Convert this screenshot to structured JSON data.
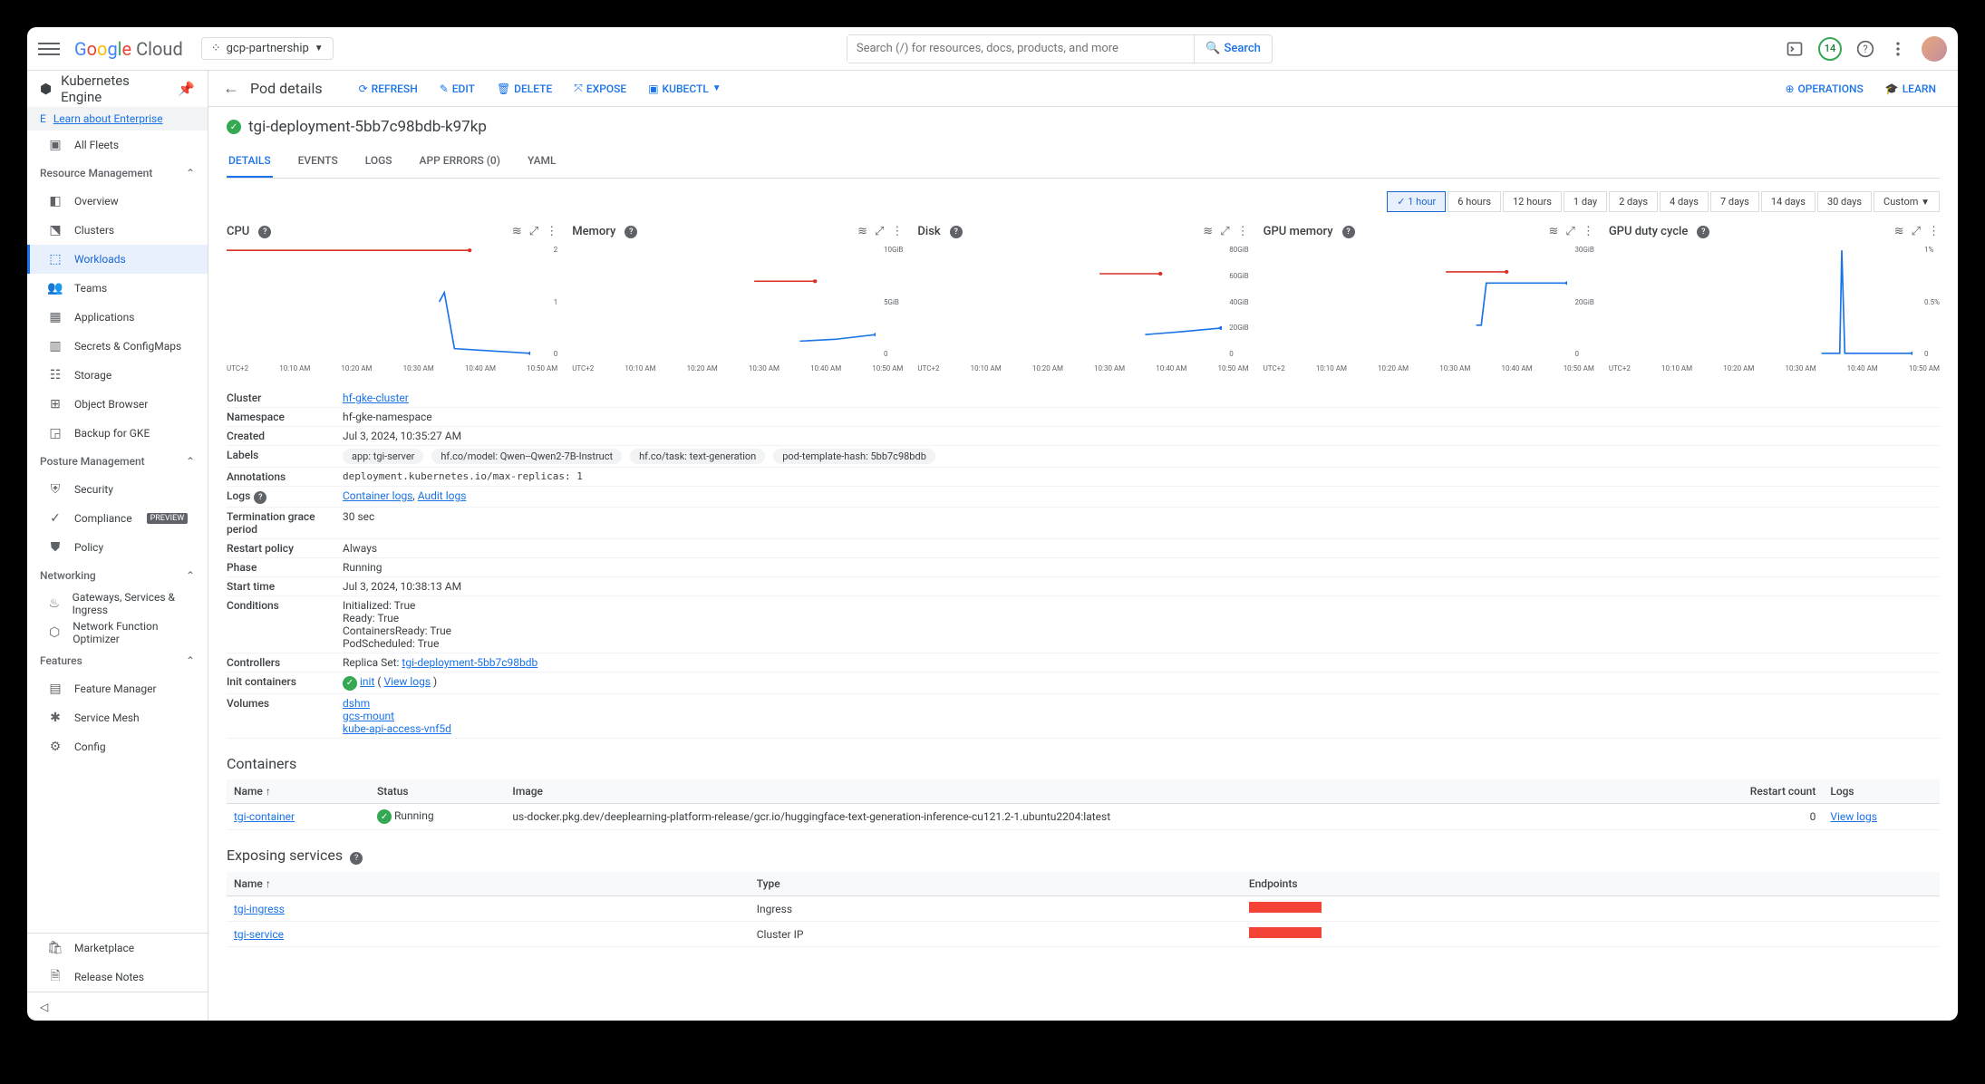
{
  "header": {
    "logo_text": "Google Cloud",
    "project": "gcp-partnership",
    "search_placeholder": "Search (/) for resources, docs, products, and more",
    "search_btn": "Search",
    "trial_badge": "14"
  },
  "sidebar": {
    "product": "Kubernetes Engine",
    "banner": "Learn about Enterprise",
    "all_fleets": "All Fleets",
    "groups": {
      "resource": "Resource Management",
      "posture": "Posture Management",
      "networking": "Networking",
      "features": "Features"
    },
    "items": {
      "overview": "Overview",
      "clusters": "Clusters",
      "workloads": "Workloads",
      "teams": "Teams",
      "applications": "Applications",
      "secrets": "Secrets & ConfigMaps",
      "storage": "Storage",
      "objbrowser": "Object Browser",
      "backup": "Backup for GKE",
      "security": "Security",
      "compliance": "Compliance",
      "policy": "Policy",
      "gateways": "Gateways, Services & Ingress",
      "nfo": "Network Function Optimizer",
      "featmgr": "Feature Manager",
      "mesh": "Service Mesh",
      "config": "Config",
      "marketplace": "Marketplace",
      "relnotes": "Release Notes"
    },
    "preview": "PREVIEW"
  },
  "subheader": {
    "title": "Pod details",
    "refresh": "Refresh",
    "edit": "Edit",
    "delete": "Delete",
    "expose": "Expose",
    "kubectl": "Kubectl",
    "operations": "Operations",
    "learn": "Learn"
  },
  "pod": {
    "name": "tgi-deployment-5bb7c98bdb-k97kp",
    "tabs": {
      "details": "DETAILS",
      "events": "EVENTS",
      "logs": "LOGS",
      "apperrors": "APP ERRORS (0)",
      "yaml": "YAML"
    }
  },
  "timerange": [
    "1 hour",
    "6 hours",
    "12 hours",
    "1 day",
    "2 days",
    "4 days",
    "7 days",
    "14 days",
    "30 days",
    "Custom"
  ],
  "charts": {
    "cpu": "CPU",
    "memory": "Memory",
    "disk": "Disk",
    "gpumem": "GPU memory",
    "gpuduty": "GPU duty cycle",
    "xaxis": [
      "UTC+2",
      "10:10 AM",
      "10:20 AM",
      "10:30 AM",
      "10:40 AM",
      "10:50 AM"
    ],
    "cpu_y": [
      "2",
      "1",
      "0"
    ],
    "mem_y": [
      "10GiB",
      "5GiB",
      "0"
    ],
    "disk_y": [
      "80GiB",
      "60GiB",
      "40GiB",
      "20GiB",
      "0"
    ],
    "gpumem_y": [
      "30GiB",
      "20GiB",
      "0"
    ],
    "gpuduty_y": [
      "1%",
      "0.5%",
      "0"
    ]
  },
  "chart_data": [
    {
      "type": "line",
      "title": "CPU",
      "series": [
        {
          "name": "limit",
          "values": [
            2,
            2,
            2,
            2,
            2,
            2
          ]
        },
        {
          "name": "usage",
          "values": [
            null,
            null,
            null,
            1.0,
            0.1,
            0.05
          ]
        }
      ],
      "x": [
        "10:00",
        "10:10",
        "10:20",
        "10:30",
        "10:40",
        "10:50"
      ],
      "ylim": [
        0,
        2
      ],
      "ylabel": ""
    },
    {
      "type": "line",
      "title": "Memory",
      "series": [
        {
          "name": "limit",
          "values": [
            10,
            10,
            10,
            10,
            10,
            10
          ]
        },
        {
          "name": "usage",
          "values": [
            null,
            null,
            null,
            null,
            1.5,
            2
          ]
        }
      ],
      "x": [
        "10:00",
        "10:10",
        "10:20",
        "10:30",
        "10:40",
        "10:50"
      ],
      "ylim": [
        0,
        10
      ],
      "ylabel": "GiB"
    },
    {
      "type": "line",
      "title": "Disk",
      "series": [
        {
          "name": "limit",
          "values": [
            60,
            60,
            60,
            60,
            60,
            60
          ]
        },
        {
          "name": "usage",
          "values": [
            null,
            null,
            null,
            null,
            20,
            22
          ]
        }
      ],
      "x": [
        "10:00",
        "10:10",
        "10:20",
        "10:30",
        "10:40",
        "10:50"
      ],
      "ylim": [
        0,
        80
      ],
      "ylabel": "GiB"
    },
    {
      "type": "line",
      "title": "GPU memory",
      "series": [
        {
          "name": "limit",
          "values": [
            30,
            30,
            30,
            30,
            30,
            30
          ]
        },
        {
          "name": "usage",
          "values": [
            null,
            null,
            null,
            8,
            20,
            20
          ]
        }
      ],
      "x": [
        "10:00",
        "10:10",
        "10:20",
        "10:30",
        "10:40",
        "10:50"
      ],
      "ylim": [
        0,
        30
      ],
      "ylabel": "GiB"
    },
    {
      "type": "line",
      "title": "GPU duty cycle",
      "series": [
        {
          "name": "usage",
          "values": [
            0,
            0,
            0,
            0,
            1,
            0
          ]
        }
      ],
      "x": [
        "10:00",
        "10:10",
        "10:20",
        "10:30",
        "10:40",
        "10:50"
      ],
      "ylim": [
        0,
        1
      ],
      "ylabel": "%"
    }
  ],
  "meta": {
    "cluster_l": "Cluster",
    "cluster_v": "hf-gke-cluster",
    "ns_l": "Namespace",
    "ns_v": "hf-gke-namespace",
    "created_l": "Created",
    "created_v": "Jul 3, 2024, 10:35:27 AM",
    "labels_l": "Labels",
    "chips": [
      "app: tgi-server",
      "hf.co/model: Qwen--Qwen2-7B-Instruct",
      "hf.co/task: text-generation",
      "pod-template-hash: 5bb7c98bdb"
    ],
    "annot_l": "Annotations",
    "annot_v": "deployment.kubernetes.io/max-replicas: 1",
    "logs_l": "Logs",
    "logs_v1": "Container logs",
    "logs_v2": "Audit logs",
    "tgp_l": "Termination grace period",
    "tgp_v": "30 sec",
    "restart_l": "Restart policy",
    "restart_v": "Always",
    "phase_l": "Phase",
    "phase_v": "Running",
    "start_l": "Start time",
    "start_v": "Jul 3, 2024, 10:38:13 AM",
    "cond_l": "Conditions",
    "cond_v": [
      "Initialized: True",
      "Ready: True",
      "ContainersReady: True",
      "PodScheduled: True"
    ],
    "ctrl_l": "Controllers",
    "ctrl_pre": "Replica Set: ",
    "ctrl_v": "tgi-deployment-5bb7c98bdb",
    "init_l": "Init containers",
    "init_v": "init",
    "init_logs": "View logs",
    "vol_l": "Volumes",
    "vol_v": [
      "dshm",
      "gcs-mount",
      "kube-api-access-vnf5d"
    ]
  },
  "containers": {
    "title": "Containers",
    "cols": {
      "name": "Name",
      "status": "Status",
      "image": "Image",
      "restart": "Restart count",
      "logs": "Logs"
    },
    "row": {
      "name": "tgi-container",
      "status": "Running",
      "image": "us-docker.pkg.dev/deeplearning-platform-release/gcr.io/huggingface-text-generation-inference-cu121.2-1.ubuntu2204:latest",
      "restart": "0",
      "logs": "View logs"
    }
  },
  "exposing": {
    "title": "Exposing services",
    "cols": {
      "name": "Name",
      "type": "Type",
      "endpoints": "Endpoints"
    },
    "rows": [
      {
        "name": "tgi-ingress",
        "type": "Ingress"
      },
      {
        "name": "tgi-service",
        "type": "Cluster IP"
      }
    ]
  }
}
